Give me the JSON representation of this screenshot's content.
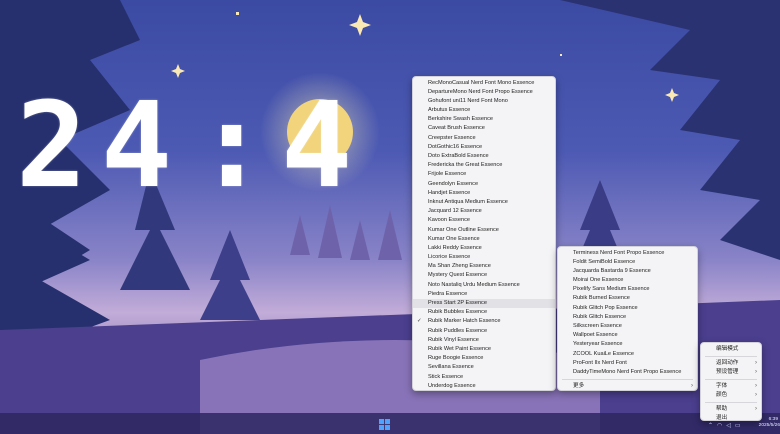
{
  "clock": {
    "h1": "2",
    "h2": "4",
    "colon": ":",
    "m1": "4",
    "m2": ""
  },
  "font_menu": {
    "items": [
      {
        "label": "RecMonoCasual Nerd Font Mono Essence"
      },
      {
        "label": "DepartureMono Nerd Font Propo Essence"
      },
      {
        "label": "Gohufont uni11 Nerd Font Mono"
      },
      {
        "label": "Arbutus Essence"
      },
      {
        "label": "Berkshire Swash Essence"
      },
      {
        "label": "Caveat Brush Essence"
      },
      {
        "label": "Creepster Essence"
      },
      {
        "label": "DotGothic16 Essence"
      },
      {
        "label": "Doto ExtraBold Essence"
      },
      {
        "label": "Fredericka the Great Essence"
      },
      {
        "label": "Frijole Essence"
      },
      {
        "label": "Geendolyn Essence"
      },
      {
        "label": "Handjet Essence"
      },
      {
        "label": "Inknut Antiqua Medium Essence"
      },
      {
        "label": "Jacquard 12 Essence"
      },
      {
        "label": "Kavoon Essence"
      },
      {
        "label": "Kumar One Outline Essence"
      },
      {
        "label": "Kumar One Essence"
      },
      {
        "label": "Lakki Reddy Essence"
      },
      {
        "label": "Licorice Essence"
      },
      {
        "label": "Ma Shan Zheng Essence"
      },
      {
        "label": "Mystery Quest Essence"
      },
      {
        "label": "Noto Nastaliq Urdu Medium Essence"
      },
      {
        "label": "Piedra Essence"
      },
      {
        "label": "Press Start 2P Essence",
        "hover": true
      },
      {
        "label": "Rubik Bubbles Essence"
      },
      {
        "label": "Rubik Marker Hatch Essence",
        "checked": true
      },
      {
        "label": "Rubik Puddles Essence"
      },
      {
        "label": "Rubik Vinyl Essence"
      },
      {
        "label": "Rubik Wet Paint Essence"
      },
      {
        "label": "Ruge Boogie Essence"
      },
      {
        "label": "Sevillana Essence"
      },
      {
        "label": "Stick Essence"
      },
      {
        "label": "Underdog Essence"
      }
    ],
    "checkmark": "✓"
  },
  "more_menu": {
    "items": [
      "Terminess Nerd Font Propo Essence",
      "Foldit SemiBold Essence",
      "Jacquarda Bastarda 9 Essence",
      "Moirai One Essence",
      "Pixelify Sans Medium Essence",
      "Rubik Burned Essence",
      "Rubik Glitch Pop Essence",
      "Rubik Glitch Essence",
      "Silkscreen Essence",
      "Wallpoet Essence",
      "Yesteryear Essence",
      "ZCOOL KuaiLe Essence",
      "ProFont IIx Nerd Font",
      "DaddyTimeMono Nerd Font Propo Essence"
    ],
    "more_label": "更多",
    "submenu_arrow": "›"
  },
  "context_menu": {
    "items": [
      {
        "label": "编辑模式",
        "arrow": false
      },
      {
        "sep": true
      },
      {
        "label": "返回动作",
        "arrow": true
      },
      {
        "label": "预设管理",
        "arrow": true
      },
      {
        "sep": true
      },
      {
        "label": "字体",
        "arrow": true
      },
      {
        "label": "颜色",
        "arrow": true
      },
      {
        "sep": true
      },
      {
        "label": "帮助",
        "arrow": true
      },
      {
        "label": "退出",
        "arrow": false
      }
    ]
  },
  "tray": {
    "time": "6:39",
    "date": "2025/5/26"
  },
  "colors": {
    "sky_top": "#3a4ba0",
    "sky_mid": "#5a64b8",
    "horizon": "#b9a6d8",
    "moon": "#f3d98a",
    "forest": "#2a3270",
    "ground": "#6a5aa8"
  }
}
